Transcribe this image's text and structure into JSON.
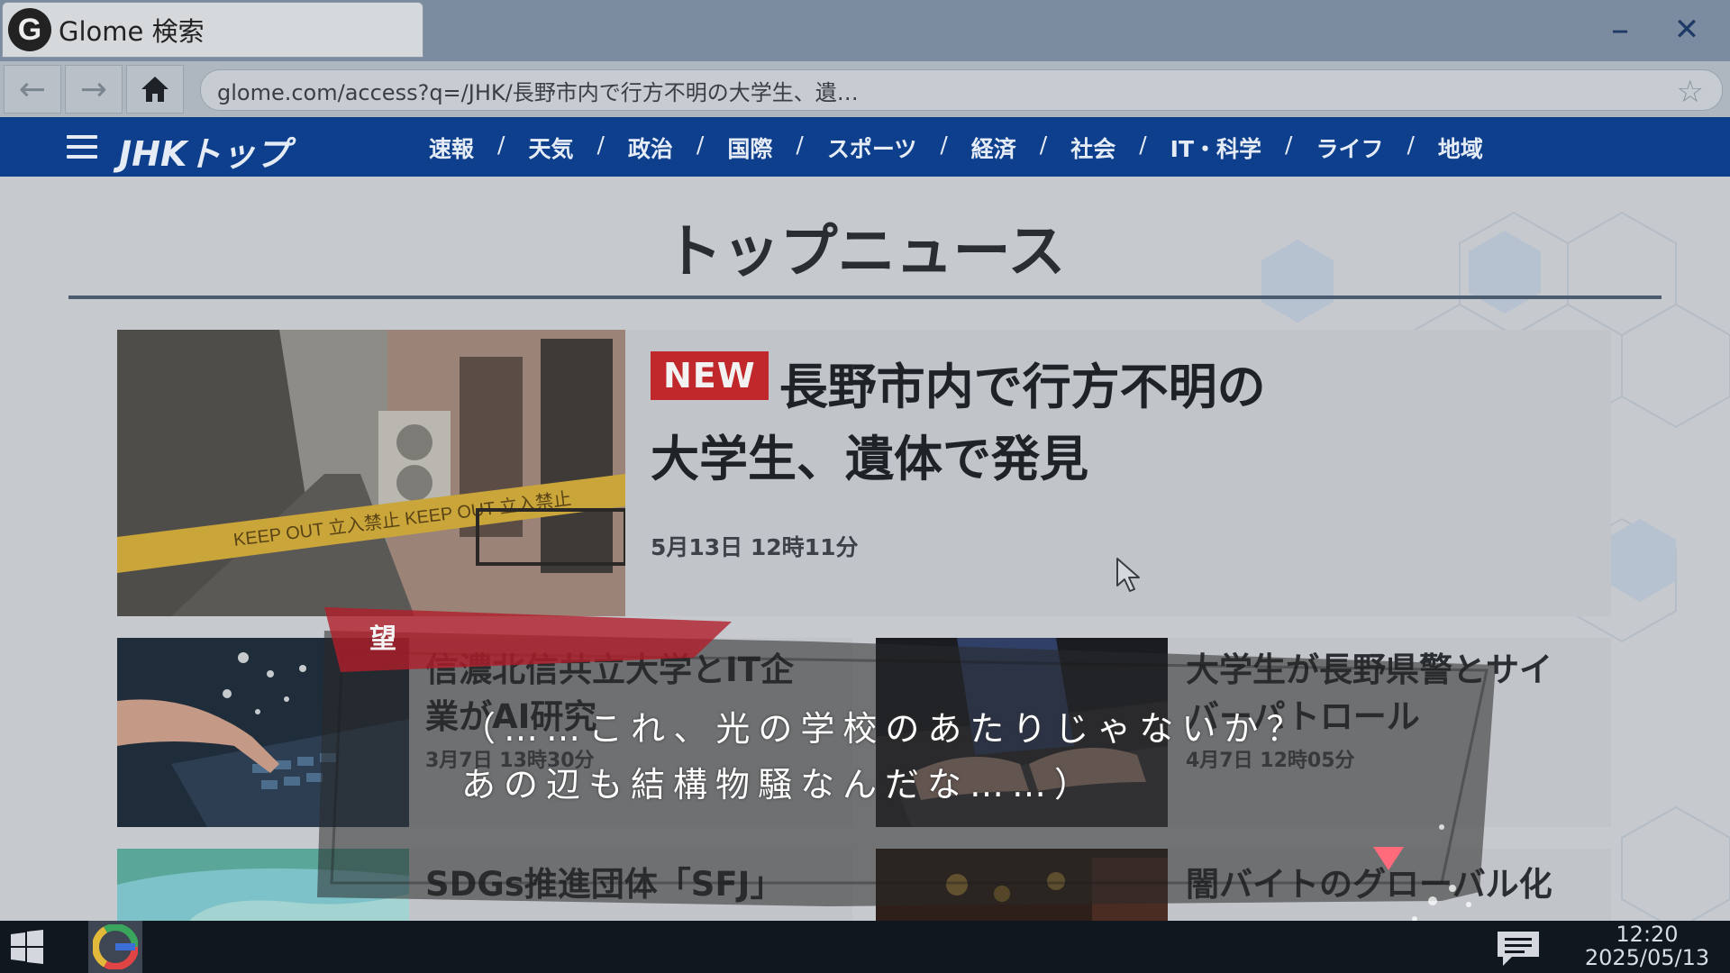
{
  "browser": {
    "tab_title": "Glome 検索",
    "logo_letter": "G",
    "minimize_glyph": "–",
    "close_glyph": "✕",
    "back_glyph": "←",
    "forward_glyph": "→",
    "url": "glome.com/access?q=/JHK/長野市内で行方不明の大学生、遺…",
    "bookmark_glyph": "☆"
  },
  "site": {
    "logo": "JHKトップ",
    "nav": [
      "速報",
      "天気",
      "政治",
      "国際",
      "スポーツ",
      "経済",
      "社会",
      "IT・科学",
      "ライフ",
      "地域"
    ],
    "nav_separator": "/",
    "page_title": "トップニュース"
  },
  "news": {
    "main": {
      "badge": "NEW",
      "headline_line1": "長野市内で行方不明の",
      "headline_line2": "大学生、遺体で発見",
      "time": "5月13日  12時11分",
      "tape_text": "KEEP OUT   立入禁止   KEEP OUT   立入禁止"
    },
    "items": [
      {
        "line1": "信濃北信共立大学とIT企",
        "line2": "業がAI研究",
        "time": "3月7日  13時30分"
      },
      {
        "line1": "大学生が長野県警とサイ",
        "line2": "バーパトロール",
        "time": "4月7日  12時05分"
      },
      {
        "line1": "SDGs推進団体「SFJ」",
        "line2": "",
        "time": ""
      },
      {
        "line1": "闇バイトのグローバル化",
        "line2": "",
        "time": ""
      }
    ]
  },
  "dialogue": {
    "speaker": "望",
    "line1": "（……これ、光の学校のあたりじゃないか？",
    "line2": "あの辺も結構物騒なんだな……）"
  },
  "taskbar": {
    "time": "12:20",
    "date": "2025/05/13"
  },
  "colors": {
    "nav_bg": "#0d3f8c",
    "badge": "#c0282c",
    "name_plate": "#b01e2a",
    "next_arrow": "#ff6b7a",
    "taskbar": "#11171f"
  }
}
